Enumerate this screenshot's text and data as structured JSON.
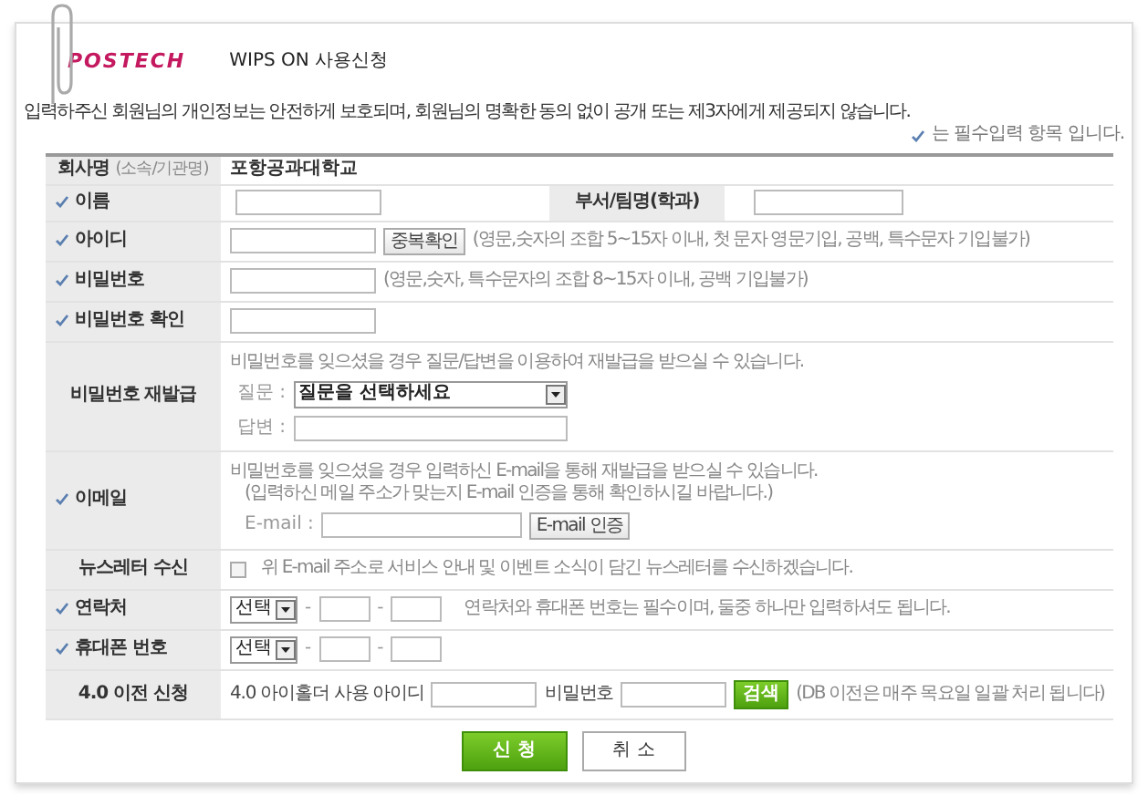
{
  "header": {
    "logo": "POSTECH",
    "title": "WIPS ON 사용신청"
  },
  "notice": "입력하주신 회원님의 개인정보는 안전하게 보호되며, 회원님의 명확한 동의 없이 공개 또는 제3자에게 제공되지 않습니다.",
  "required_note": "는 필수입력 항목 입니다.",
  "rows": [
    {
      "kind": "text",
      "label": "회사명",
      "label_note": "(소속/기관명)",
      "required": false,
      "value": "포항공과대학교"
    },
    {
      "kind": "split",
      "label": "이름",
      "required": true,
      "second_label": "부서/팀명(학과)"
    },
    {
      "kind": "input",
      "label": "아이디",
      "required": true,
      "button": "중복확인",
      "hint": "(영문,숫자의 조합 5~15자 이내, 첫 문자 영문기입, 공백, 특수문자 기입불가)"
    },
    {
      "kind": "input",
      "label": "비밀번호",
      "required": true,
      "hint": "(영문,숫자, 특수문자의 조합 8~15자 이내, 공백 기입불가)"
    },
    {
      "kind": "input",
      "label": "비밀번호 확인",
      "required": true
    },
    {
      "kind": "recovery",
      "label": "비밀번호 재발급",
      "required": false,
      "intro": "비밀번호를 잊으셨을 경우 질문/답변을 이용하여 재발급을 받으실 수 있습니다.",
      "question_label": "질문 :",
      "question_value": "질문을 선택하세요",
      "answer_label": "답변 :"
    },
    {
      "kind": "email",
      "label": "이메일",
      "required": true,
      "intro": "비밀번호를 잊으셨을 경우 입력하신 E-mail을 통해 재발급을 받으실 수 있습니다.",
      "sub": "(입력하신 메일 주소가 맞는지 E-mail 인증을 통해 확인하시길 바랍니다.)",
      "field_label": "E-mail :",
      "button": "E-mail 인증"
    },
    {
      "kind": "checkbox",
      "label": "뉴스레터 수신",
      "required": false,
      "checked": false,
      "text": "위 E-mail 주소로 서비스 안내 및 이벤트 소식이 담긴 뉴스레터를 수신하겠습니다."
    },
    {
      "kind": "phone",
      "label": "연락처",
      "required": true,
      "select": "선택",
      "separators": [
        "-",
        "-"
      ],
      "hint": "연락처와 휴대폰 번호는 필수이며, 둘중 하나만 입력하셔도 됩니다."
    },
    {
      "kind": "phone",
      "label": "휴대폰 번호",
      "required": true,
      "select": "선택",
      "separators": [
        "-",
        "-"
      ]
    },
    {
      "kind": "migrate",
      "label": "4.0 이전 신청",
      "required": false,
      "id_label": "4.0 아이홀더 사용 아이디",
      "pw_label": "비밀번호",
      "button": "검색",
      "note": "(DB 이전은 매주 목요일 일괄 처리 됩니다)"
    }
  ],
  "buttons": [
    {
      "label": "신 청",
      "kind": "primary"
    },
    {
      "label": "취 소",
      "kind": "secondary"
    }
  ]
}
